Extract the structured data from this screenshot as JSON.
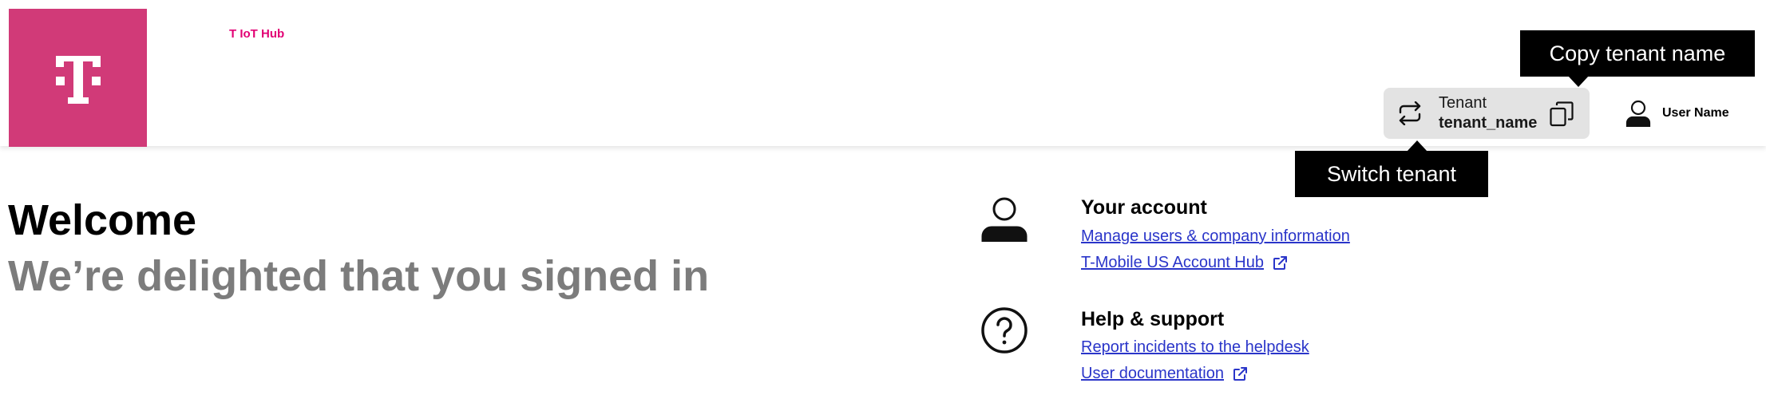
{
  "header": {
    "app_name": "T IoT Hub",
    "brand_color": "#d13a78",
    "app_name_color": "#e20074"
  },
  "tenant": {
    "label": "Tenant",
    "name": "tenant_name",
    "switch_icon": "switch-arrows-icon",
    "copy_icon": "copy-icon"
  },
  "user": {
    "name": "User Name",
    "icon": "user-icon"
  },
  "tooltips": {
    "copy": "Copy tenant name",
    "switch": "Switch tenant"
  },
  "main": {
    "title": "Welcome",
    "subtitle": "We’re delighted that you signed in"
  },
  "account": {
    "title": "Your account",
    "icon": "user-icon",
    "links": [
      {
        "label": "Manage users & company information",
        "external": false
      },
      {
        "label": "T-Mobile US Account Hub",
        "external": true
      }
    ]
  },
  "support": {
    "title": "Help & support",
    "icon": "question-circle-icon",
    "links": [
      {
        "label": "Report incidents to the helpdesk",
        "external": false
      },
      {
        "label": "User documentation",
        "external": true
      }
    ]
  },
  "colors": {
    "link": "#2a35c9",
    "subtitle": "#7c7c7c",
    "tenant_bg": "#e3e3e3",
    "tooltip_bg": "#000000"
  }
}
